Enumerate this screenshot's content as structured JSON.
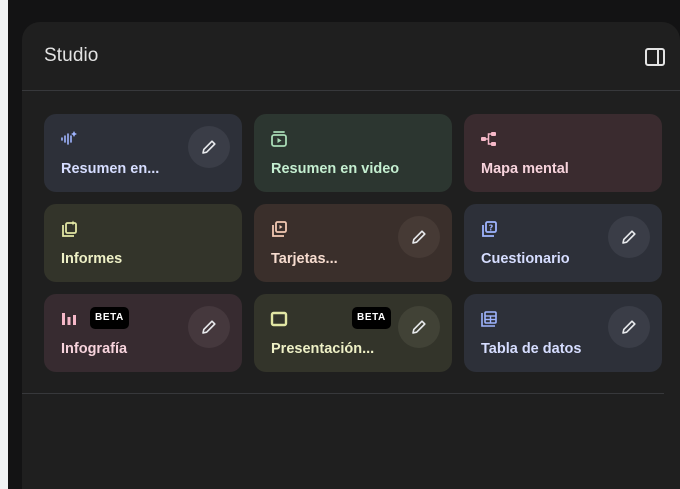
{
  "studio": {
    "title": "Studio",
    "tiles": [
      {
        "label": "Resumen en...",
        "icon": "audio-overview-icon",
        "has_edit": true
      },
      {
        "label": "Resumen en video",
        "icon": "video-overview-icon",
        "has_edit": false
      },
      {
        "label": "Mapa mental",
        "icon": "mind-map-icon",
        "has_edit": false
      },
      {
        "label": "Informes",
        "icon": "reports-icon",
        "has_edit": false
      },
      {
        "label": "Tarjetas...",
        "icon": "flashcards-icon",
        "has_edit": true
      },
      {
        "label": "Cuestionario",
        "icon": "quiz-icon",
        "has_edit": true
      },
      {
        "label": "Infografía",
        "icon": "infographic-icon",
        "has_edit": true,
        "badge": "BETA"
      },
      {
        "label": "Presentación...",
        "icon": "presentation-icon",
        "has_edit": true,
        "badge": "BETA"
      },
      {
        "label": "Tabla de datos",
        "icon": "data-table-icon",
        "has_edit": true
      }
    ]
  },
  "colors": {
    "panel_bg": "#1f1f1f",
    "outer_bg": "#131314",
    "tile_blue": "#2d3039",
    "tile_green": "#2c3630",
    "tile_rose": "#3a2b2f",
    "tile_olive": "#33342a",
    "tile_brown": "#3a2f2b",
    "tile_plum": "#372b30"
  }
}
